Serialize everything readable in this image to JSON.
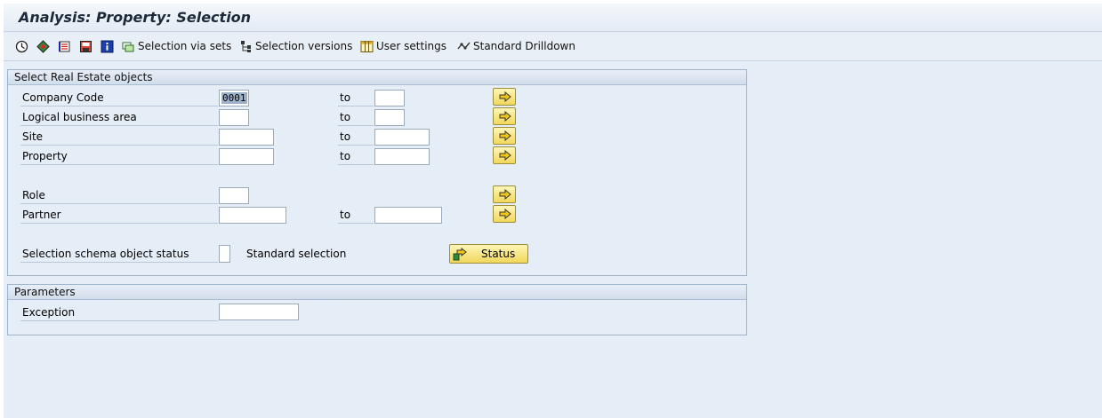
{
  "window": {
    "title": "Analysis: Property: Selection"
  },
  "toolbar": {
    "items": [
      {
        "label": "",
        "icon": "execute-icon"
      },
      {
        "label": "",
        "icon": "execute-background-icon"
      },
      {
        "label": "",
        "icon": "variants-icon"
      },
      {
        "label": "",
        "icon": "save-variant-icon"
      },
      {
        "label": "",
        "icon": "info-icon"
      },
      {
        "label": "Selection via sets",
        "icon": "sets-icon"
      },
      {
        "label": "Selection versions",
        "icon": "hierarchy-icon"
      },
      {
        "label": "User settings",
        "icon": "table-settings-icon"
      },
      {
        "label": "Standard Drilldown",
        "icon": "drilldown-icon"
      }
    ]
  },
  "re_objects": {
    "header": "Select Real Estate objects",
    "to_label": "to",
    "rows": [
      {
        "label": "Company Code",
        "from": "0001",
        "to": ""
      },
      {
        "label": "Logical business area",
        "from": "",
        "to": ""
      },
      {
        "label": "Site",
        "from": "",
        "to": ""
      },
      {
        "label": "Property",
        "from": "",
        "to": ""
      },
      {
        "label": "Role",
        "from": ""
      },
      {
        "label": "Partner",
        "from": "",
        "to": ""
      }
    ],
    "schema": {
      "label": "Selection schema object status",
      "value": "",
      "text": "Standard selection",
      "button": "Status"
    }
  },
  "parameters": {
    "header": "Parameters",
    "rows": [
      {
        "label": "Exception",
        "value": ""
      }
    ]
  },
  "colors": {
    "background": "#e5edf6",
    "button_yellow": "#f1d75b",
    "group_border": "#9db4cd"
  }
}
